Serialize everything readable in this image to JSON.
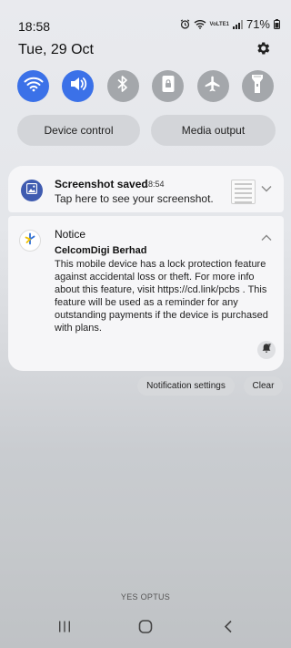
{
  "status_bar": {
    "time": "18:58",
    "network_label": "VoLTE1",
    "battery": "71%"
  },
  "header": {
    "date": "Tue, 29 Oct"
  },
  "quick_settings": {
    "toggles": [
      {
        "name": "wifi",
        "icon": "wifi-icon",
        "state": "on"
      },
      {
        "name": "sound",
        "icon": "speaker-icon",
        "state": "on"
      },
      {
        "name": "bluetooth",
        "icon": "bluetooth-icon",
        "state": "off"
      },
      {
        "name": "screen-lock-rotation",
        "icon": "lock-rotation-icon",
        "state": "off"
      },
      {
        "name": "airplane-mode",
        "icon": "airplane-icon",
        "state": "off"
      },
      {
        "name": "flashlight",
        "icon": "flashlight-icon",
        "state": "off"
      }
    ],
    "device_control_label": "Device control",
    "media_output_label": "Media output"
  },
  "notifications": {
    "screenshot": {
      "title": "Screenshot saved",
      "time": "18:54",
      "text": "Tap here to see your screenshot."
    },
    "notice": {
      "title": "Notice",
      "sender": "CelcomDigi Berhad",
      "body": "This mobile device has a lock protection feature against accidental loss or theft. For more info about this feature, visit https://cd.link/pcbs . This feature will be used as a reminder for any outstanding payments if the device is purchased with plans."
    },
    "settings_label": "Notification settings",
    "clear_label": "Clear"
  },
  "carrier": "YES OPTUS",
  "colors": {
    "accent_on": "#3b71e8",
    "toggle_off": "#a4a7ab",
    "card_bg": "#f6f6f8"
  }
}
